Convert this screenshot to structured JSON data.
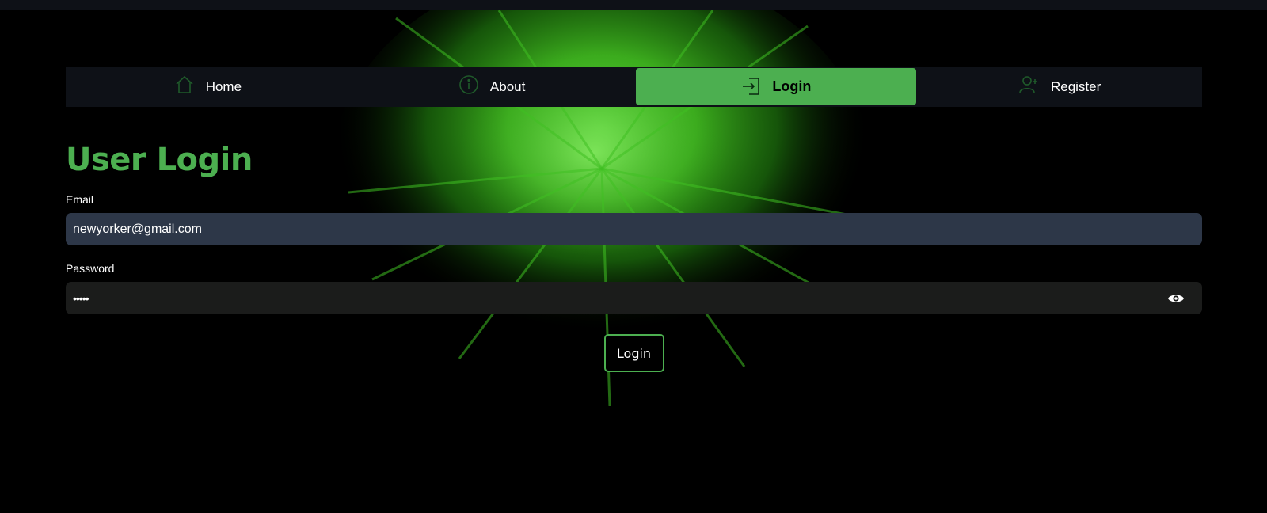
{
  "nav": {
    "items": [
      {
        "label": "Home",
        "icon": "home-icon",
        "active": false
      },
      {
        "label": "About",
        "icon": "info-icon",
        "active": false
      },
      {
        "label": "Login",
        "icon": "login-icon",
        "active": true
      },
      {
        "label": "Register",
        "icon": "add-user-icon",
        "active": false
      }
    ]
  },
  "page": {
    "title": "User Login"
  },
  "form": {
    "email_label": "Email",
    "email_value": "newyorker@gmail.com",
    "password_label": "Password",
    "password_value": "•••••",
    "submit_label": "Login"
  },
  "colors": {
    "accent": "#4caf50",
    "nav_background": "#0e1117",
    "email_field_background": "#2d3748",
    "password_field_background": "#1b1c1b",
    "page_background": "#000000"
  }
}
